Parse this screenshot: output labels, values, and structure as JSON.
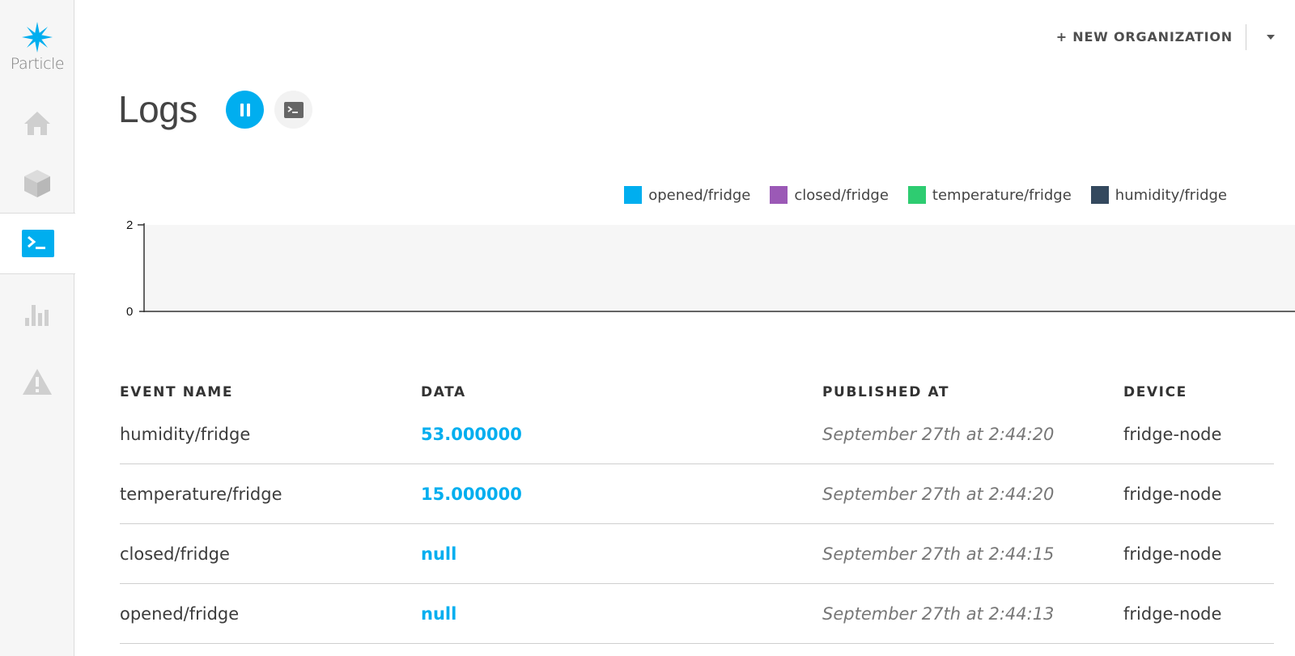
{
  "brand": {
    "name": "Particle"
  },
  "header": {
    "new_org_label": "+ NEW ORGANIZATION"
  },
  "page": {
    "title": "Logs"
  },
  "colors": {
    "accent": "#00aeef",
    "opened": "#00aeef",
    "closed": "#9b59b6",
    "temperature": "#2ecc71",
    "humidity": "#34495e"
  },
  "legend": [
    {
      "label": "opened/fridge",
      "color": "#00aeef"
    },
    {
      "label": "closed/fridge",
      "color": "#9b59b6"
    },
    {
      "label": "temperature/fridge",
      "color": "#2ecc71"
    },
    {
      "label": "humidity/fridge",
      "color": "#34495e"
    }
  ],
  "chart": {
    "y_max_label": "2",
    "y_min_label": "0"
  },
  "table": {
    "headers": {
      "event_name": "EVENT NAME",
      "data": "DATA",
      "published_at": "PUBLISHED AT",
      "device": "DEVICE"
    },
    "rows": [
      {
        "event": "humidity/fridge",
        "data": "53.000000",
        "published": "September 27th at 2:44:20",
        "device": "fridge-node"
      },
      {
        "event": "temperature/fridge",
        "data": "15.000000",
        "published": "September 27th at 2:44:20",
        "device": "fridge-node"
      },
      {
        "event": "closed/fridge",
        "data": "null",
        "published": "September 27th at 2:44:15",
        "device": "fridge-node"
      },
      {
        "event": "opened/fridge",
        "data": "null",
        "published": "September 27th at 2:44:13",
        "device": "fridge-node"
      }
    ]
  },
  "icons": {
    "logo": "particle-star-icon",
    "nav": [
      "home-icon",
      "device-cube-icon",
      "console-icon",
      "analytics-bars-icon",
      "alert-icon"
    ],
    "pause": "pause-icon",
    "terminal": "terminal-icon",
    "caret": "chevron-down-icon"
  }
}
